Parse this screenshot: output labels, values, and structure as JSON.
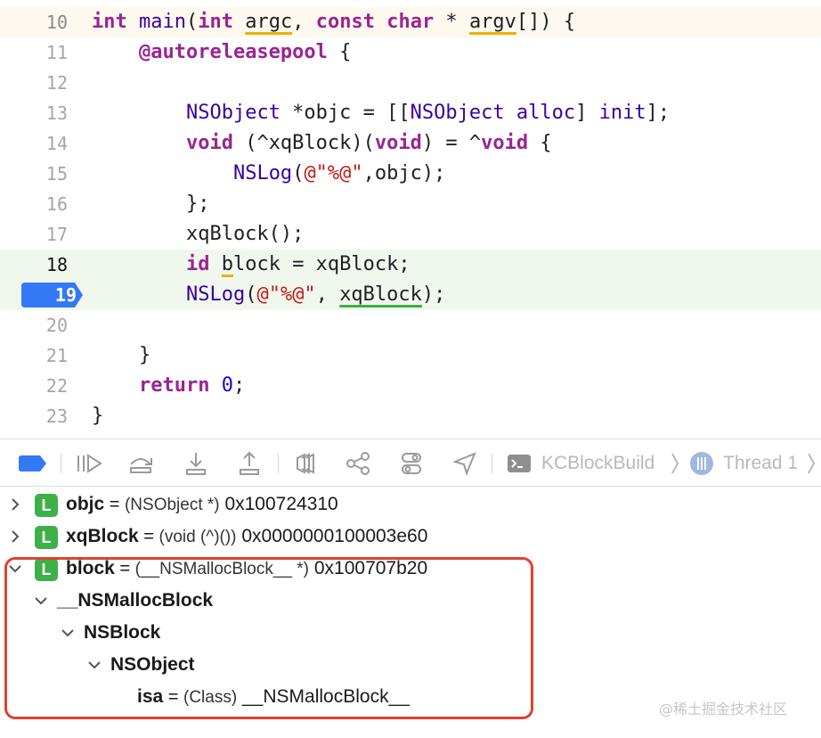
{
  "editor": {
    "lines": [
      {
        "num": "10"
      },
      {
        "num": "11"
      },
      {
        "num": "12"
      },
      {
        "num": "13"
      },
      {
        "num": "14"
      },
      {
        "num": "15"
      },
      {
        "num": "16"
      },
      {
        "num": "17"
      },
      {
        "num": "18"
      },
      {
        "num": "19"
      },
      {
        "num": "20"
      },
      {
        "num": "21"
      },
      {
        "num": "22"
      },
      {
        "num": "23"
      }
    ],
    "code": {
      "l10": [
        "int",
        " ",
        "main",
        "(",
        "int",
        " ",
        "argc",
        ", ",
        "const",
        " ",
        "char",
        " * ",
        "argv",
        "[]) {"
      ],
      "l11": [
        "    ",
        "@autoreleasepool",
        " {"
      ],
      "l13": [
        "        ",
        "NSObject",
        " *objc = [[",
        "NSObject",
        " ",
        "alloc",
        "] ",
        "init",
        "];"
      ],
      "l14": [
        "        ",
        "void",
        " (^xqBlock)(",
        "void",
        ") = ^",
        "void",
        " {"
      ],
      "l15": [
        "            ",
        "NSLog",
        "(",
        "@\"%@\"",
        ",objc);"
      ],
      "l16": [
        "        };"
      ],
      "l17": [
        "        xqBlock();"
      ],
      "l18": [
        "        ",
        "id",
        " ",
        "b",
        "lock = xqBlock;"
      ],
      "l19": [
        "        ",
        "NSLog",
        "(",
        "@\"%@\"",
        ", ",
        "xqBlock",
        ");"
      ],
      "l21": [
        "    }"
      ],
      "l22": [
        "    ",
        "return",
        " ",
        "0",
        ";"
      ],
      "l23": [
        "}"
      ]
    },
    "breakpoint_line": "19"
  },
  "toolbar": {
    "buttons": [
      "breakpoints-toggle",
      "continue",
      "step-over",
      "step-into",
      "step-out",
      "view-hierarchy",
      "memory-graph",
      "environment-overrides",
      "simulate-location"
    ],
    "target": "KCBlockBuild",
    "thread": "Thread 1"
  },
  "variables": [
    {
      "name": "objc",
      "eq": " = ",
      "type": "(NSObject *)",
      "value": " 0x100724310",
      "badge": "L"
    },
    {
      "name": "xqBlock",
      "eq": " = ",
      "type": "(void (^)())",
      "value": " 0x0000000100003e60",
      "badge": "L"
    },
    {
      "name": "block",
      "eq": " = ",
      "type": "(__NSMallocBlock__ *)",
      "value": " 0x100707b20",
      "badge": "L"
    },
    {
      "name": "__NSMallocBlock"
    },
    {
      "name": "NSBlock"
    },
    {
      "name": "NSObject"
    },
    {
      "name": "isa",
      "eq": " = ",
      "type": "(Class)",
      "value": " __NSMallocBlock__"
    }
  ],
  "colors": {
    "keyword": "#9b2393",
    "class": "#3900a0",
    "string": "#c41a16",
    "number": "#1c00cf",
    "breakpoint": "#3478f6",
    "highlight_box": "#e0412e",
    "local_badge": "#3db04a"
  },
  "watermark": "@稀土掘金技术社区"
}
